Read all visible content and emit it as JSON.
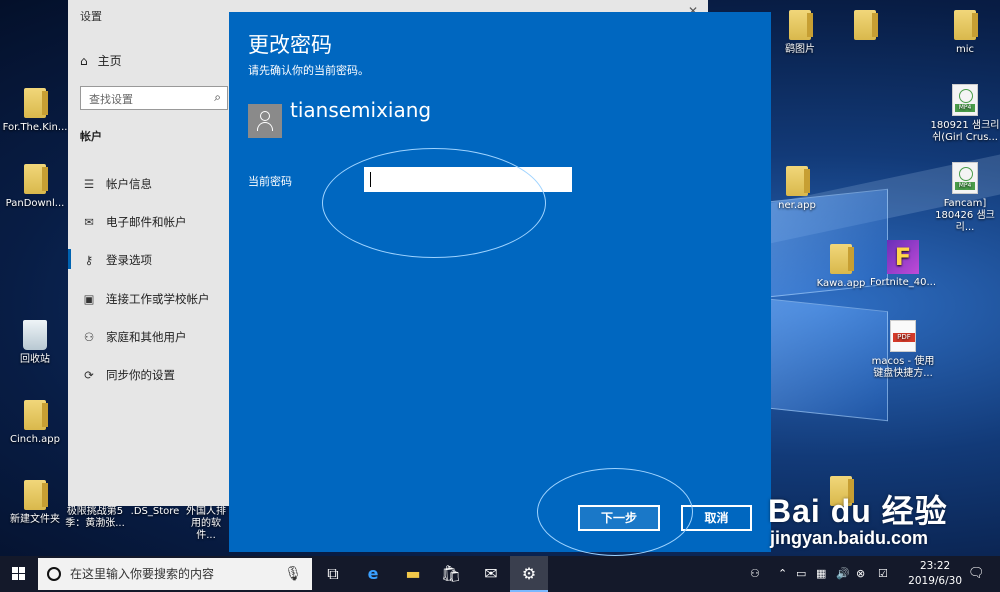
{
  "desktop": {
    "icons": [
      {
        "label": "For.The.Kin..."
      },
      {
        "label": "PanDownl..."
      },
      {
        "label": "回收站"
      },
      {
        "label": "Cinch.app"
      },
      {
        "label": "新建文件夹"
      },
      {
        "label": "极限挑战第5季：黄渤张..."
      },
      {
        "label": ".DS_Store"
      },
      {
        "label": "外国人排用的软件..."
      },
      {
        "label": "鹞图片"
      },
      {
        "label": "mic"
      },
      {
        "label": "180921 샘크리쉬(Girl Crus..."
      },
      {
        "label": "Fancam] 180426 샘크리..."
      },
      {
        "label": "ner.app"
      },
      {
        "label": "Kawa.app"
      },
      {
        "label": "Fortnite_40..."
      },
      {
        "label": "macos - 使用键盘快捷方..."
      }
    ],
    "file_tags": {
      "mp4": "MP4",
      "pdf": "PDF"
    }
  },
  "settings": {
    "title": "设置",
    "home": "主页",
    "search_placeholder": "查找设置",
    "section": "帐户",
    "nav": [
      {
        "label": "帐户信息",
        "icon": "account-info-icon"
      },
      {
        "label": "电子邮件和帐户",
        "icon": "email-icon"
      },
      {
        "label": "登录选项",
        "icon": "key-icon"
      },
      {
        "label": "连接工作或学校帐户",
        "icon": "briefcase-icon"
      },
      {
        "label": "家庭和其他用户",
        "icon": "add-person-icon"
      },
      {
        "label": "同步你的设置",
        "icon": "sync-icon"
      }
    ]
  },
  "dialog": {
    "title": "更改密码",
    "subtitle": "请先确认你的当前密码。",
    "username": "tiansemixiang",
    "password_label": "当前密码",
    "password_value": "",
    "next_button": "下一步",
    "cancel_button": "取消"
  },
  "taskbar": {
    "search_placeholder": "在这里输入你要搜索的内容",
    "time": "23:22",
    "date": "2019/6/30"
  },
  "watermark": {
    "logo": "Bai du 经验",
    "url": "jingyan.baidu.com"
  },
  "colors": {
    "dialog_bg": "#0067c0",
    "taskbar_bg": "#14192a",
    "highlight_ellipse": "#9ed3ff"
  }
}
